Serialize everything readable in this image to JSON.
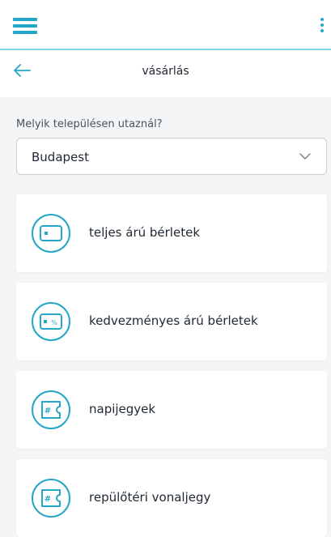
{
  "header": {
    "menu_icon": "hamburger-menu-icon",
    "more_icon": "more-vertical-icon"
  },
  "subheader": {
    "title": "vásárlás",
    "back_icon": "back-arrow-icon"
  },
  "location": {
    "question": "Melyik településen utaznál?",
    "selected": "Budapest"
  },
  "options": [
    {
      "label": "teljes árú bérletek",
      "icon": "full-price-pass-icon"
    },
    {
      "label": "kedvezményes árú bérletek",
      "icon": "discount-pass-icon"
    },
    {
      "label": "napijegyek",
      "icon": "daily-ticket-icon"
    },
    {
      "label": "repülőtéri vonaljegy",
      "icon": "airport-ticket-icon"
    }
  ],
  "colors": {
    "accent": "#23a6c8",
    "divider": "#7fd3e6",
    "background": "#f4f5f6"
  }
}
